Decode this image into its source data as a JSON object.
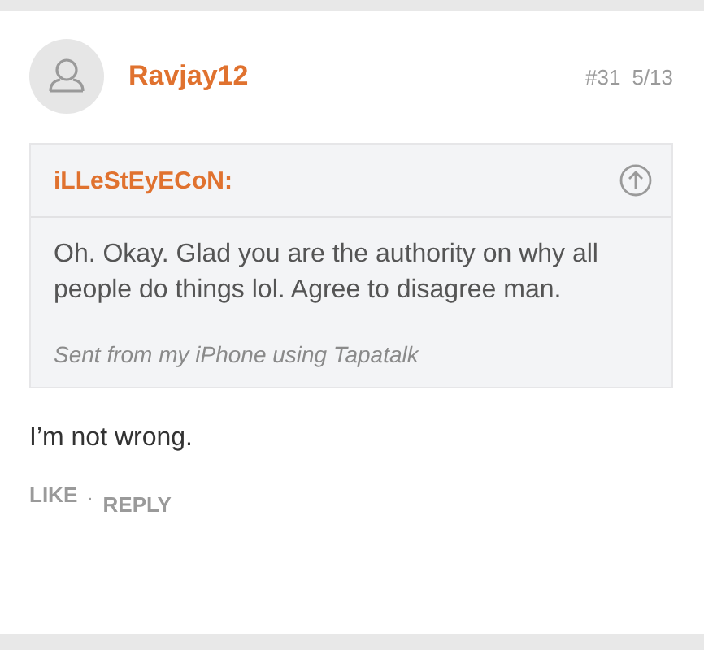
{
  "post": {
    "author": "Ravjay12",
    "number": "#31",
    "date": "5/13",
    "quote": {
      "author": "iLLeStEyECoN:",
      "text": "Oh. Okay. Glad you are the authority on why all people do things lol. Agree to disagree man.",
      "signature": "Sent from my iPhone using Tapatalk"
    },
    "body": "I’m not wrong.",
    "actions": [
      {
        "label": "LIKE"
      },
      {
        "label": "REPLY"
      }
    ],
    "separator": "·"
  }
}
